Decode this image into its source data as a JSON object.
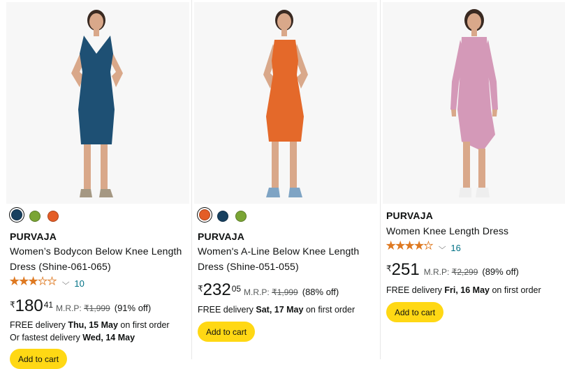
{
  "products": [
    {
      "brand": "PURVAJA",
      "title_line1": "Women’s Bodycon Below Knee Length",
      "title_line2": "Dress (Shine-061-065)",
      "rating": 3.5,
      "stars_text": "★★★★★",
      "rating_count": "10",
      "currency": "₹",
      "price_whole": "180",
      "price_fraction": "41",
      "mrp_label": "M.R.P:",
      "mrp_value": "₹1,999",
      "discount": "(91% off)",
      "delivery_prefix": "FREE delivery",
      "delivery_date": "Thu, 15 May",
      "delivery_suffix": "on first order",
      "fastest_prefix": "Or fastest delivery",
      "fastest_date": "Wed, 14 May",
      "add_to_cart": "Add to cart",
      "swatches": [
        "#17405f",
        "#7aa534",
        "#e45d26"
      ],
      "dress_color": "#1e5074"
    },
    {
      "brand": "PURVAJA",
      "title_line1": "Women's A-Line Below Knee Length",
      "title_line2": "Dress (Shine-051-055)",
      "currency": "₹",
      "price_whole": "232",
      "price_fraction": "05",
      "mrp_label": "M.R.P:",
      "mrp_value": "₹1,999",
      "discount": "(88% off)",
      "delivery_prefix": "FREE delivery",
      "delivery_date": "Sat, 17 May",
      "delivery_suffix": "on first order",
      "add_to_cart": "Add to cart",
      "swatches": [
        "#e45d26",
        "#17405f",
        "#7aa534"
      ],
      "dress_color": "#e4692a"
    },
    {
      "brand": "PURVAJA",
      "title_line1": "Women Knee Length Dress",
      "rating": 4.0,
      "stars_text": "★★★★★",
      "rating_count": "16",
      "currency": "₹",
      "price_whole": "251",
      "mrp_label": "M.R.P:",
      "mrp_value": "₹2,299",
      "discount": "(89% off)",
      "delivery_prefix": "FREE delivery",
      "delivery_date": "Fri, 16 May",
      "delivery_suffix": "on first order",
      "add_to_cart": "Add to cart",
      "dress_color": "#d499b8"
    }
  ]
}
